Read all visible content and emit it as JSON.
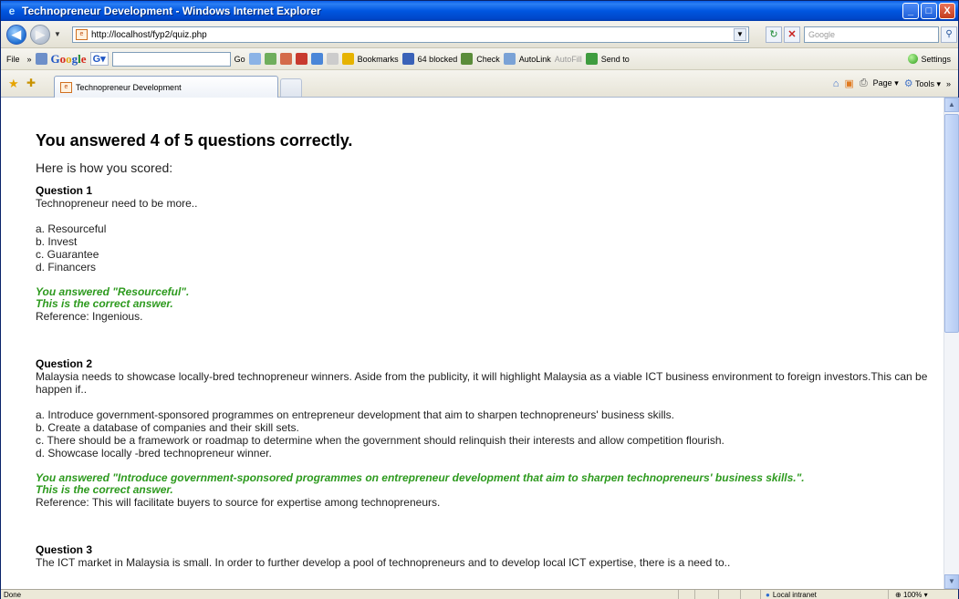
{
  "window": {
    "title": "Technopreneur Development - Windows Internet Explorer",
    "buttons": {
      "minimize": "_",
      "maximize": "□",
      "close": "X"
    }
  },
  "addressbar": {
    "url": "http://localhost/fyp2/quiz.php",
    "search_placeholder": "Google"
  },
  "google_toolbar": {
    "file_label": "File",
    "logo": {
      "G": "G",
      "o1": "o",
      "o2": "o",
      "g": "g",
      "l": "l",
      "e": "e"
    },
    "go_label": "Go",
    "bookmarks_label": "Bookmarks",
    "blocked_label": "64 blocked",
    "check_label": "Check",
    "autolink_label": "AutoLink",
    "autofill_label": "AutoFill",
    "sendto_label": "Send to",
    "settings_label": "Settings"
  },
  "tabs": [
    {
      "label": "Technopreneur Development"
    }
  ],
  "commandbar": {
    "page_label": "Page",
    "tools_label": "Tools"
  },
  "page": {
    "heading": "You answered 4 of 5 questions correctly.",
    "lead": "Here is how you scored:",
    "questions": [
      {
        "title": "Question 1",
        "text": "Technopreneur need to be more..",
        "options": [
          "a. Resourceful",
          "b. Invest",
          "c. Guarantee",
          "d. Financers"
        ],
        "answered": "You answered \"Resourceful\".",
        "verdict": "This is the correct answer.",
        "reference": "Reference: Ingenious."
      },
      {
        "title": "Question 2",
        "text": "Malaysia needs to showcase locally-bred technopreneur winners. Aside from the publicity, it will highlight Malaysia as a viable ICT business environment to foreign investors.This can be happen if..",
        "options": [
          "a. Introduce government-sponsored programmes on entrepreneur development that aim to sharpen technopreneurs' business skills.",
          "b. Create a database of companies and their skill sets.",
          "c. There should be a framework or roadmap to determine when the government should relinquish their interests and allow competition flourish.",
          "d. Showcase locally -bred technopreneur winner."
        ],
        "answered": "You answered \"Introduce government-sponsored programmes on entrepreneur development that aim to sharpen technopreneurs' business skills.\".",
        "verdict": "This is the correct answer.",
        "reference": "Reference: This will facilitate buyers to source for expertise among technopreneurs."
      },
      {
        "title": "Question 3",
        "text": "The ICT market in Malaysia is small. In order to further develop a pool of technopreneurs and to develop local ICT expertise, there is a need to.."
      }
    ]
  },
  "statusbar": {
    "status": "Done",
    "zone": "Local intranet",
    "zoom": "100%"
  }
}
